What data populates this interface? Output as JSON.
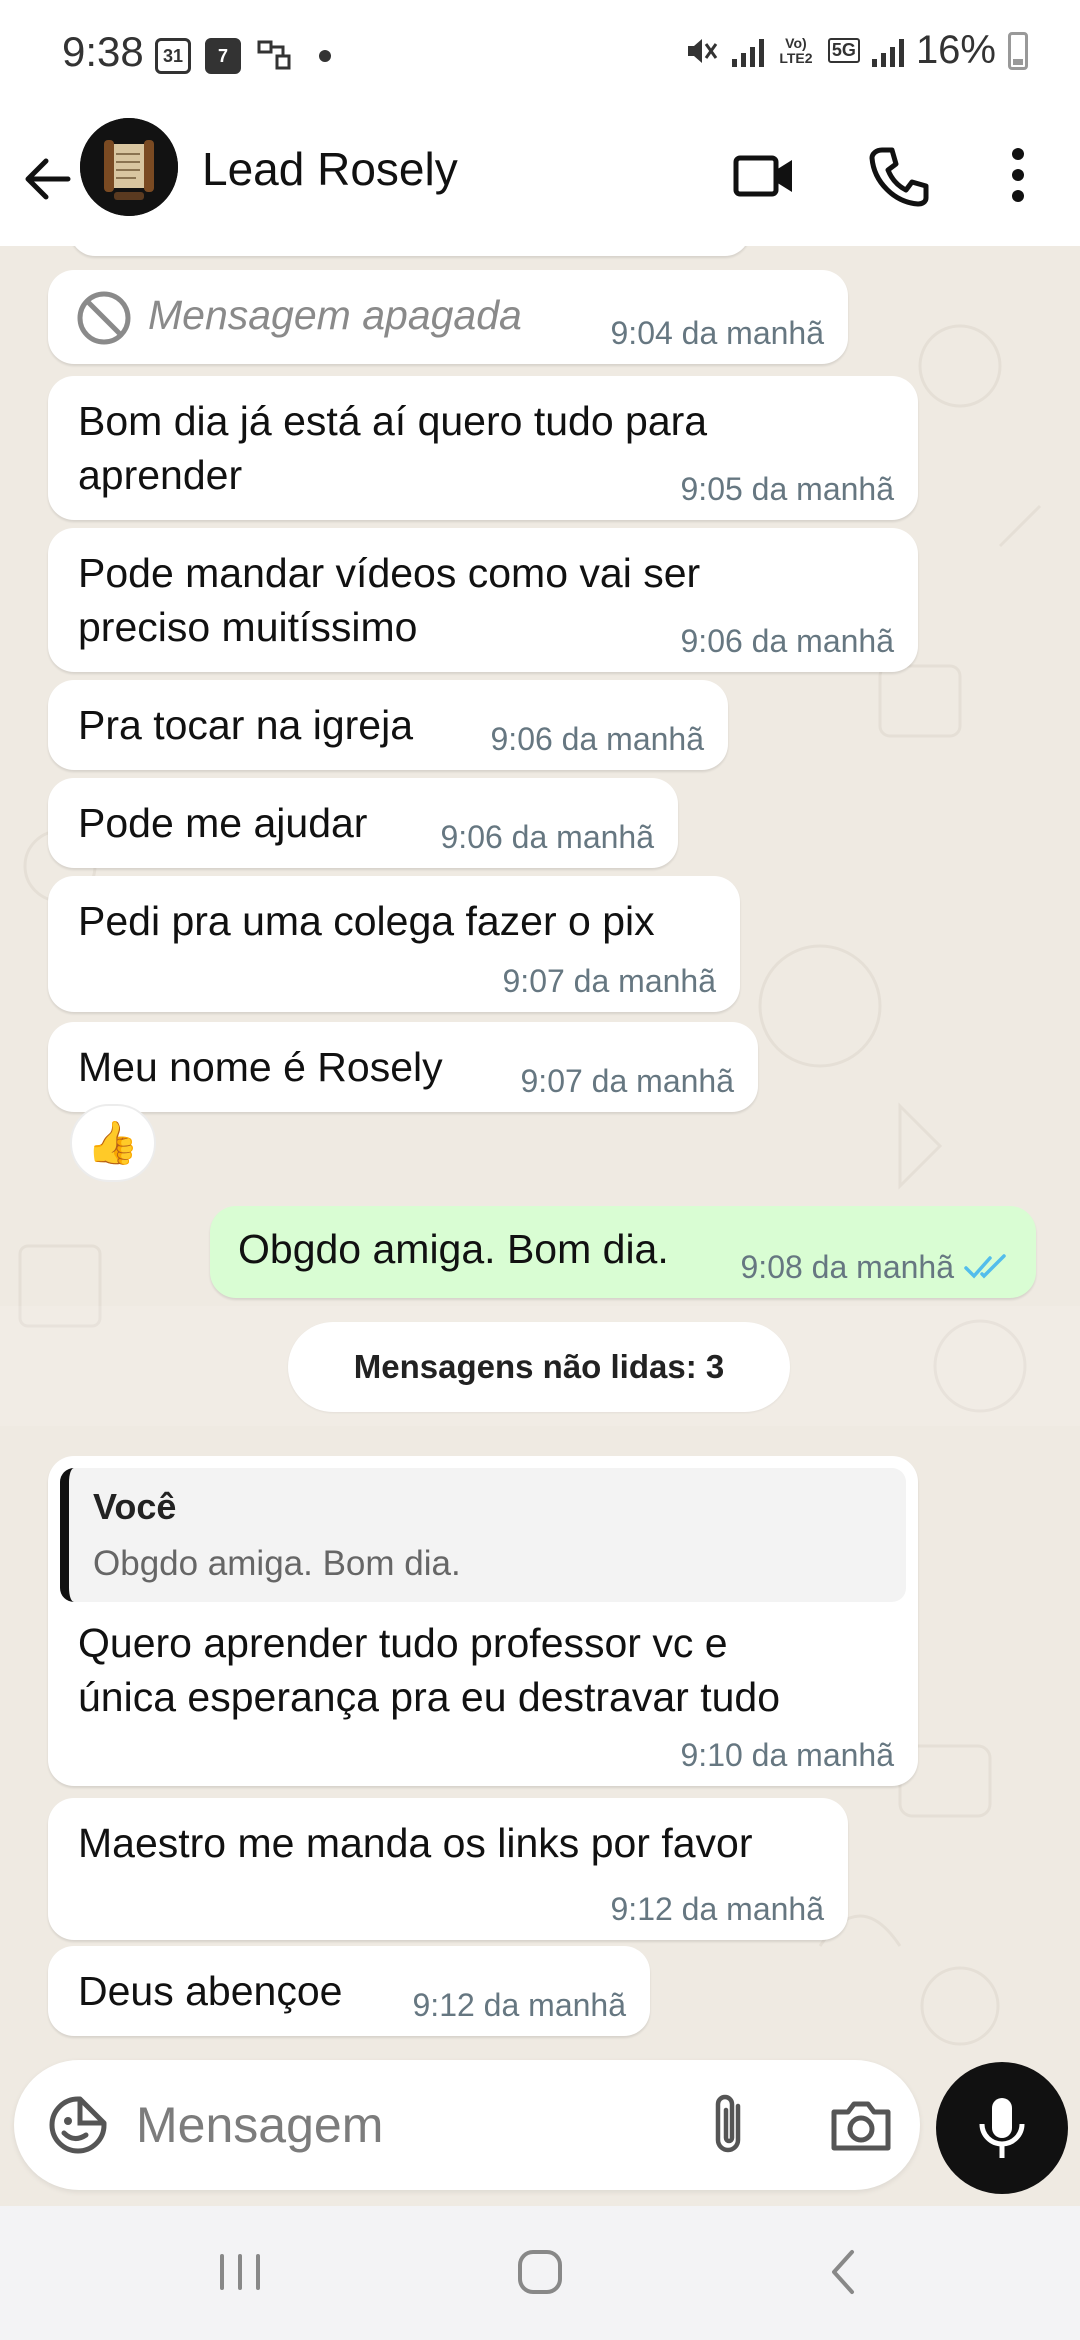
{
  "status_bar": {
    "time": "9:38",
    "calendar_day": "31",
    "notification_badge": "7",
    "lte_label": "Vo) LTE2",
    "network": "5G",
    "battery": "16%"
  },
  "header": {
    "contact_name": "Lead Rosely"
  },
  "messages": [
    {
      "type": "deleted",
      "direction": "in",
      "text": "Mensagem apagada",
      "time": "9:04 da manhã"
    },
    {
      "type": "text",
      "direction": "in",
      "text": "Bom dia já está aí quero  tudo para\naprender",
      "time": "9:05 da manhã"
    },
    {
      "type": "text",
      "direction": "in",
      "text": "Pode mandar vídeos como vai ser\npreciso  muitíssimo",
      "time": "9:06 da manhã"
    },
    {
      "type": "text",
      "direction": "in",
      "text": "Pra tocar na igreja",
      "time": "9:06 da manhã"
    },
    {
      "type": "text",
      "direction": "in",
      "text": "Pode me ajudar",
      "time": "9:06 da manhã"
    },
    {
      "type": "text",
      "direction": "in",
      "text": "Pedi pra uma colega  fazer o pix",
      "time": "9:07 da manhã"
    },
    {
      "type": "text",
      "direction": "in",
      "text": "Meu nome é Rosely",
      "time": "9:07 da manhã",
      "reaction": "👍"
    },
    {
      "type": "text",
      "direction": "out",
      "text": "Obgdo amiga. Bom dia.",
      "time": "9:08 da manhã",
      "status": "read"
    },
    {
      "type": "text",
      "direction": "in",
      "quote_author": "Você",
      "quote_text": "Obgdo amiga. Bom dia.",
      "text": "Quero  aprender tudo  professor vc e\núnica esperança pra eu destravar tudo",
      "time": "9:10 da manhã"
    },
    {
      "type": "text",
      "direction": "in",
      "text": "Maestro me manda os links por favor",
      "time": "9:12 da manhã"
    },
    {
      "type": "text",
      "direction": "in",
      "text": "Deus abençoe",
      "time": "9:12 da manhã"
    }
  ],
  "unread_divider": "Mensagens não lidas: 3",
  "composer": {
    "placeholder": "Mensagem"
  },
  "colors": {
    "chat_background": "#efeae2",
    "outgoing_bubble": "#d9fdd3",
    "incoming_bubble": "#ffffff",
    "read_ticks": "#53bdeb"
  }
}
